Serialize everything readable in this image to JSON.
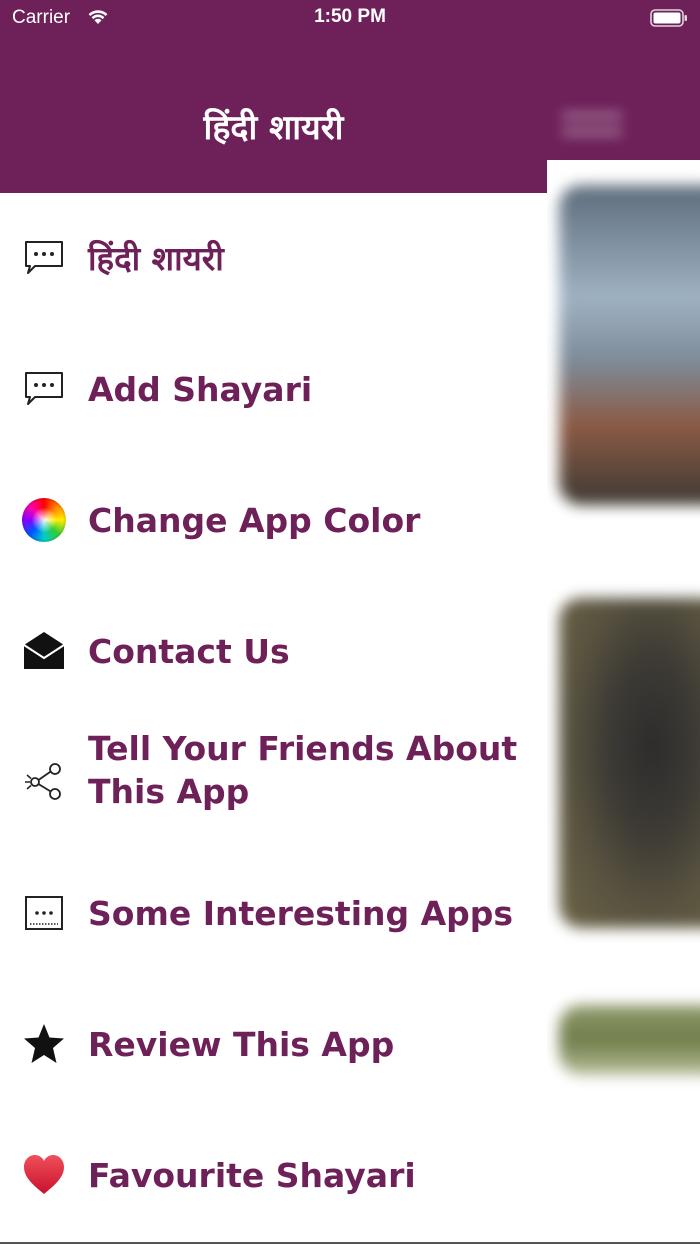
{
  "status_bar": {
    "carrier": "Carrier",
    "time": "1:50 PM"
  },
  "drawer": {
    "title": "हिंदी शायरी",
    "header_color": "#6e2159",
    "label_color": "#6e2159",
    "items": [
      {
        "label": "हिंदी शायरी",
        "icon": "chat-bubble-icon"
      },
      {
        "label": "Add Shayari",
        "icon": "chat-bubble-icon"
      },
      {
        "label": "Change App Color",
        "icon": "color-wheel-icon"
      },
      {
        "label": "Contact Us",
        "icon": "envelope-icon"
      },
      {
        "label": "Tell Your Friends About This App",
        "icon": "share-icon"
      },
      {
        "label": "Some Interesting Apps",
        "icon": "apps-box-icon"
      },
      {
        "label": "Review This App",
        "icon": "star-icon"
      },
      {
        "label": "Favourite Shayari",
        "icon": "heart-icon"
      }
    ]
  }
}
